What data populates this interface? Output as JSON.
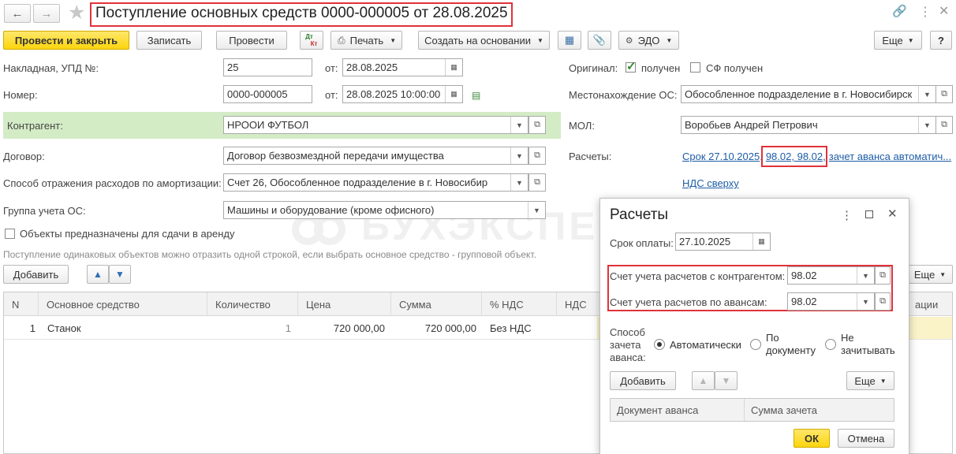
{
  "header": {
    "title": "Поступление основных средств 0000-000005 от 28.08.2025"
  },
  "toolbar": {
    "post_close": "Провести и закрыть",
    "save": "Записать",
    "post": "Провести",
    "dt_kt_top": "Дт",
    "dt_kt_bottom": "Кт",
    "print": "Печать",
    "create_based": "Создать на основании",
    "edo": "ЭДО",
    "more": "Еще",
    "help": "?"
  },
  "form": {
    "invoice_label": "Накладная, УПД №:",
    "invoice_value": "25",
    "from_label": "от:",
    "invoice_date": "28.08.2025",
    "number_label": "Номер:",
    "number_value": "0000-000005",
    "number_date": "28.08.2025 10:00:00",
    "counterparty_label": "Контрагент:",
    "counterparty_value": "НРООИ ФУТБОЛ",
    "contract_label": "Договор:",
    "contract_value": "Договор безвозмездной передачи имущества",
    "amort_label": "Способ отражения расходов по амортизации:",
    "amort_value": "Счет 26, Обособленное подразделение в г. Новосибир",
    "group_label": "Группа учета ОС:",
    "group_value": "Машины и оборудование (кроме офисного)",
    "rent_label": "Объекты предназначены для сдачи в аренду",
    "hint": "Поступление одинаковых объектов можно отразить одной строкой, если выбрать основное средство - групповой объект.",
    "original_label": "Оригинал:",
    "received_label": "получен",
    "sf_label": "СФ получен",
    "location_label": "Местонахождение ОС:",
    "location_value": "Обособленное подразделение в г. Новосибирск",
    "mol_label": "МОЛ:",
    "mol_value": "Воробьев Андрей Петрович",
    "settlements_label": "Расчеты:",
    "settlements_link_1": "Срок 27.10.2025,",
    "settlements_link_2": "98.02, 98.02,",
    "settlements_link_3": "зачет аванса автоматич...",
    "vat_link": "НДС сверху"
  },
  "table": {
    "add": "Добавить",
    "more": "Еще",
    "columns": [
      "N",
      "Основное средство",
      "Количество",
      "Цена",
      "Сумма",
      "% НДС",
      "НДС",
      "ации"
    ],
    "rows": [
      {
        "n": "1",
        "asset": "Станок",
        "qty": "1",
        "price": "720 000,00",
        "sum": "720 000,00",
        "vat_rate": "Без НДС"
      }
    ]
  },
  "dialog": {
    "title": "Расчеты",
    "due_label": "Срок оплаты:",
    "due_value": "27.10.2025",
    "acc_contractor_label": "Счет учета расчетов с контрагентом:",
    "acc_contractor_value": "98.02",
    "acc_advance_label": "Счет учета расчетов по авансам:",
    "acc_advance_value": "98.02",
    "offset_label_1": "Способ",
    "offset_label_2": "зачета",
    "offset_label_3": "аванса:",
    "opt_auto": "Автоматически",
    "opt_doc_1": "По",
    "opt_doc_2": "документу",
    "opt_none_1": "Не",
    "opt_none_2": "зачитывать",
    "add": "Добавить",
    "more": "Еще",
    "col_doc": "Документ аванса",
    "col_sum": "Сумма зачета",
    "ok": "ОК",
    "cancel": "Отмена"
  },
  "watermark": "БУХЭКСПЕРТ",
  "colors": {
    "primary_button": "#fcd50d",
    "link": "#1d5da6",
    "highlight_box": "#e0323a",
    "counterparty_bg": "#d4ecc6"
  }
}
